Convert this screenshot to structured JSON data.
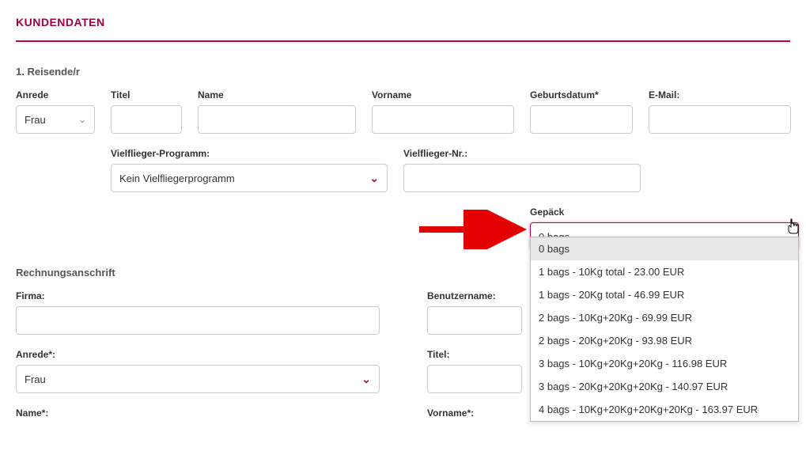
{
  "page": {
    "title": "KUNDENDATEN"
  },
  "traveler": {
    "heading": "1. Reisende/r",
    "anrede_label": "Anrede",
    "anrede_value": "Frau",
    "titel_label": "Titel",
    "titel_value": "",
    "name_label": "Name",
    "name_value": "",
    "vorname_label": "Vorname",
    "vorname_value": "",
    "geburtsdatum_label": "Geburtsdatum*",
    "geburtsdatum_value": "",
    "email_label": "E-Mail:",
    "email_value": "",
    "ff_program_label": "Vielflieger-Programm:",
    "ff_program_value": "Kein Vielfliegerprogramm",
    "ff_number_label": "Vielflieger-Nr.:",
    "ff_number_value": "",
    "gepack_label": "Gepäck",
    "gepack_value": "0 bags",
    "gepack_options": [
      "0 bags",
      "1 bags - 10Kg total - 23.00 EUR",
      "1 bags - 20Kg total - 46.99 EUR",
      "2 bags - 10Kg+20Kg - 69.99 EUR",
      "2 bags - 20Kg+20Kg - 93.98 EUR",
      "3 bags - 10Kg+20Kg+20Kg - 116.98 EUR",
      "3 bags - 20Kg+20Kg+20Kg - 140.97 EUR",
      "4 bags - 10Kg+20Kg+20Kg+20Kg - 163.97 EUR"
    ]
  },
  "billing": {
    "heading": "Rechnungsanschrift",
    "firma_label": "Firma:",
    "firma_value": "",
    "benutzername_label": "Benutzername:",
    "benutzername_value": "",
    "anrede_label": "Anrede*:",
    "anrede_value": "Frau",
    "titel_label": "Titel:",
    "titel_value": "",
    "name_label": "Name*:",
    "vorname_label": "Vorname*:"
  }
}
